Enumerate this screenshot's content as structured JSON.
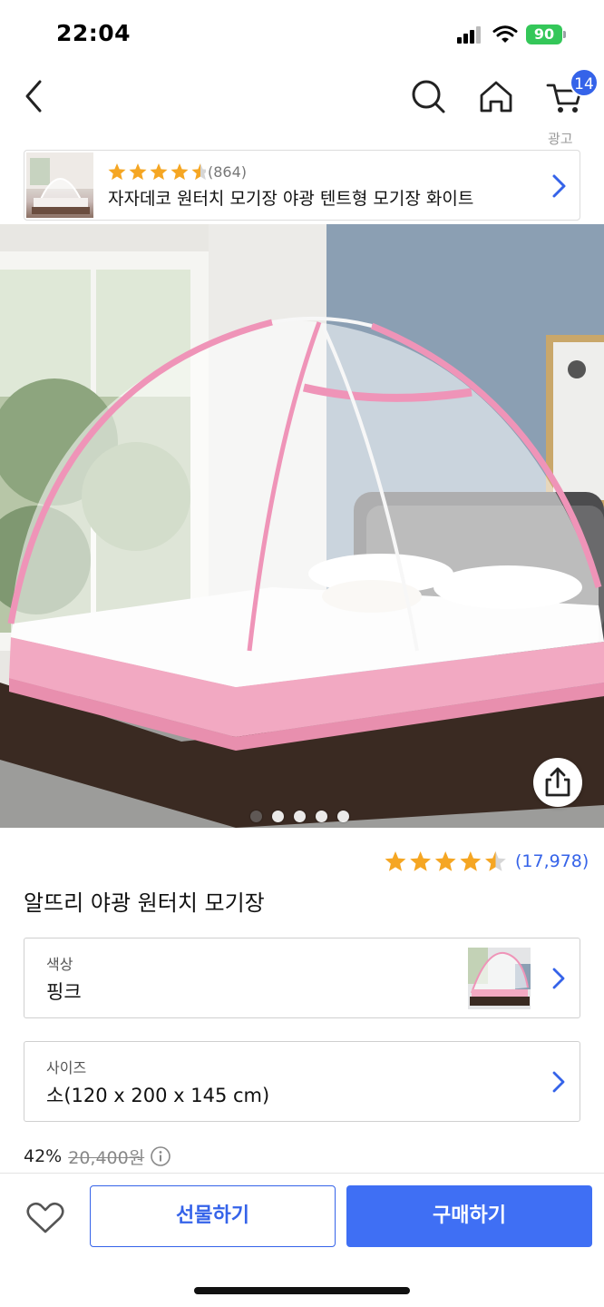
{
  "status_bar": {
    "time": "22:04",
    "battery": "90"
  },
  "header": {
    "back_icon": "chevron-left-icon",
    "search_icon": "search-icon",
    "home_icon": "home-icon",
    "cart_icon": "cart-icon",
    "cart_count": "14",
    "ad_label": "광고"
  },
  "ad_banner": {
    "rating": 4.5,
    "review_count": "(864)",
    "title": "자자데코 원터치 모기장 야광 텐트형 모기장 화이트"
  },
  "product": {
    "image_count": 5,
    "active_image": 1,
    "rating": 4.5,
    "review_count": "(17,978)",
    "title": "알뜨리 야광 원터치 모기장"
  },
  "options": {
    "color": {
      "label": "색상",
      "value": "핑크"
    },
    "size": {
      "label": "사이즈",
      "value": "소(120 x 200 x 145 cm)"
    }
  },
  "price": {
    "discount": "42%",
    "original": "20,400원"
  },
  "actions": {
    "gift_label": "선물하기",
    "buy_label": "구매하기"
  },
  "colors": {
    "accent": "#3563e9",
    "star": "#f5a623",
    "battery": "#34c759"
  }
}
